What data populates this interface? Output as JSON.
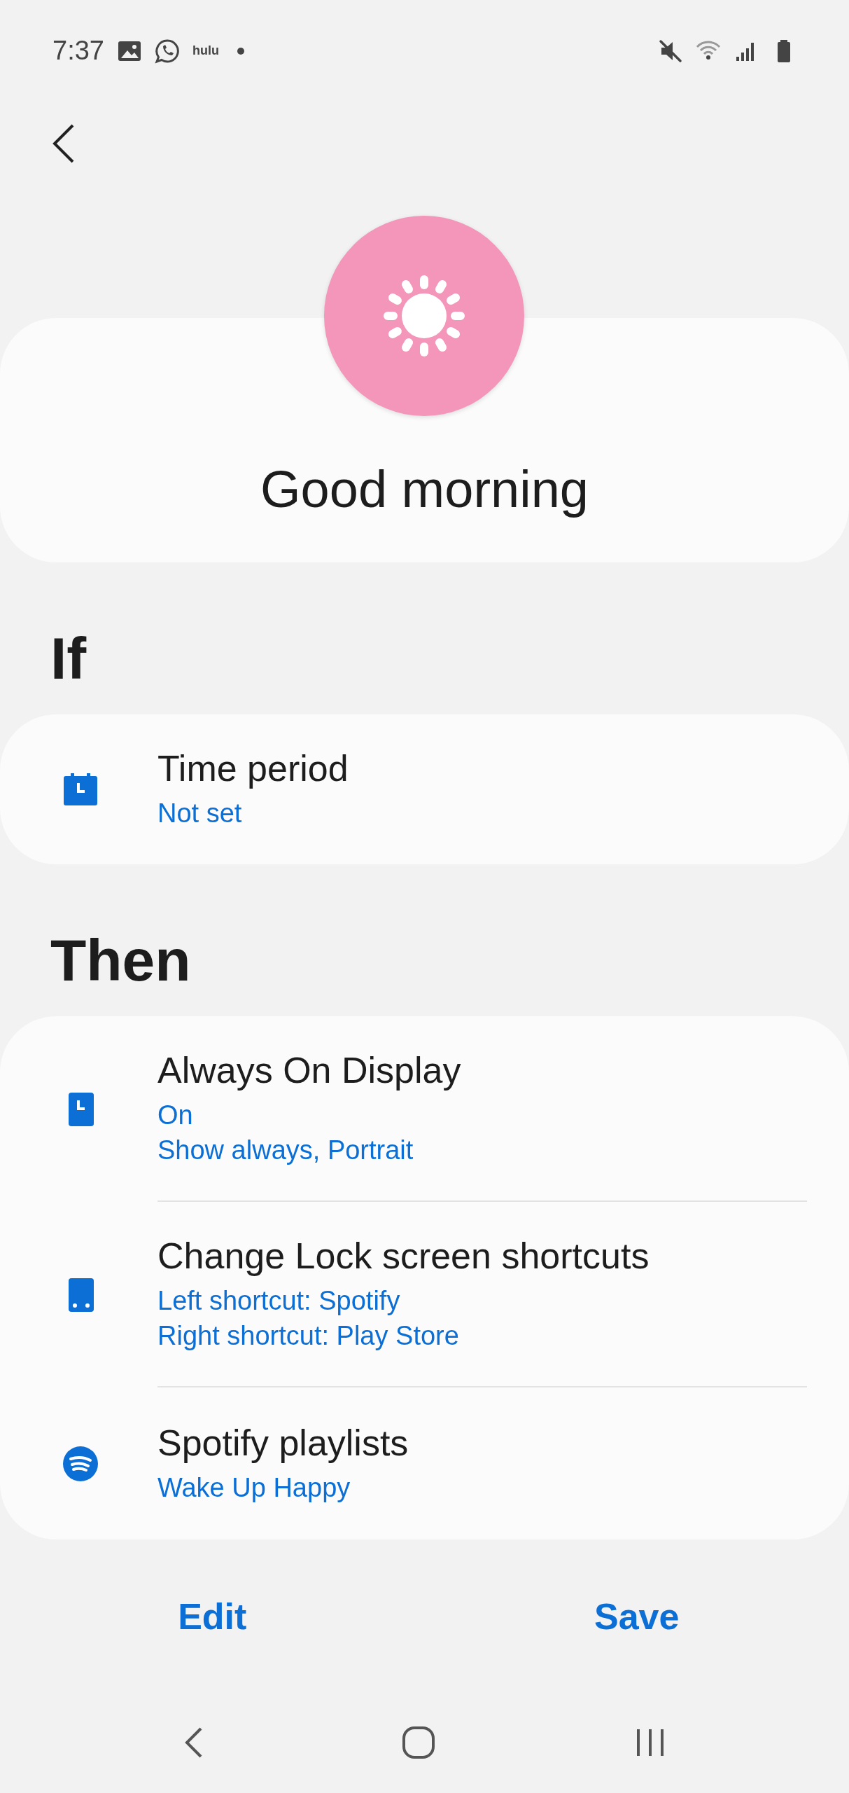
{
  "status_bar": {
    "time": "7:37",
    "app_label": "hulu"
  },
  "routine": {
    "title": "Good morning"
  },
  "if": {
    "heading": "If",
    "items": [
      {
        "kind": "calendar",
        "title": "Time period",
        "details": [
          "Not set"
        ]
      }
    ]
  },
  "then": {
    "heading": "Then",
    "items": [
      {
        "kind": "clock",
        "title": "Always On Display",
        "details": [
          "On",
          "Show always, Portrait"
        ]
      },
      {
        "kind": "phone",
        "title": "Change Lock screen shortcuts",
        "details": [
          "Left shortcut: Spotify",
          "Right shortcut: Play Store"
        ]
      },
      {
        "kind": "music",
        "title": "Spotify playlists",
        "details": [
          "Wake Up Happy"
        ]
      }
    ]
  },
  "buttons": [
    "Edit",
    "Save"
  ]
}
